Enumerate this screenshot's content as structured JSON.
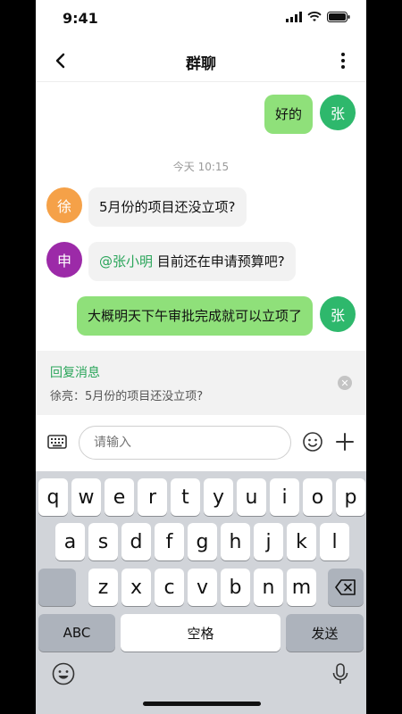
{
  "status_bar": {
    "time": "9:41"
  },
  "header": {
    "title": "群聊"
  },
  "messages": [
    {
      "sender": "me",
      "avatar_text": "张",
      "avatar_color": "#2eb86c",
      "text": "好的"
    },
    {
      "type": "time",
      "text": "今天 10:15"
    },
    {
      "sender": "other",
      "avatar_text": "徐",
      "avatar_color": "#f5a148",
      "text": "5月份的项目还没立项?"
    },
    {
      "sender": "other",
      "avatar_text": "申",
      "avatar_color": "#9c2aa8",
      "mention": "@张小明",
      "text": " 目前还在申请预算吧?"
    },
    {
      "sender": "me",
      "avatar_text": "张",
      "avatar_color": "#2eb86c",
      "text": "大概明天下午审批完成就可以立项了"
    }
  ],
  "reply": {
    "title": "回复消息",
    "quote": "徐亮：5月份的项目还没立项?"
  },
  "input": {
    "placeholder": "请输入"
  },
  "keyboard": {
    "row1": [
      "q",
      "w",
      "e",
      "r",
      "t",
      "y",
      "u",
      "i",
      "o",
      "p"
    ],
    "row2": [
      "a",
      "s",
      "d",
      "f",
      "g",
      "h",
      "j",
      "k",
      "l"
    ],
    "row3": [
      "z",
      "x",
      "c",
      "v",
      "b",
      "n",
      "m"
    ],
    "abc_label": "ABC",
    "space_label": "空格",
    "send_label": "发送"
  },
  "colors": {
    "accent": "#2aa55a",
    "my_bubble": "#8fe07a",
    "other_bubble": "#f2f2f2"
  }
}
